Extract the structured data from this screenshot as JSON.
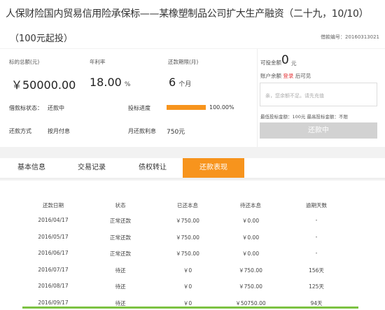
{
  "header": {
    "title": "人保财险国内贸易信用险承保标——某橡塑制品公司扩大生产融资（二十九，10/10）",
    "subtitle": "（100元起投）",
    "loan_no": "借款编号：20160313021"
  },
  "stats": {
    "total_label": "标的总额(元)",
    "total_value": "￥50000.00",
    "rate_label": "年利率",
    "rate_value": "18.00",
    "rate_unit": "%",
    "term_label": "还款期限(月)",
    "term_value": "6",
    "term_unit": "个月"
  },
  "info": {
    "status_label": "借款标状态：",
    "status_value": "还款中",
    "progress_label": "投标进度",
    "progress_value": "100.00%",
    "progress_fraction": 1.0,
    "method_label": "还款方式",
    "method_value": "按月付息",
    "monthly_label": "月还款利息",
    "monthly_value": "750元"
  },
  "invest": {
    "available_label": "可投金额",
    "available_value": "0",
    "available_unit": "元",
    "balance_prefix": "账户余额",
    "login_link": "登录",
    "balance_suffix": "后可见",
    "input_placeholder": "亲，您余额不足。请先充值",
    "limits": "最低投标金额：100元 最高投标金额：不限",
    "button_label": "还款中"
  },
  "tabs": [
    "基本信息",
    "交易记录",
    "债权转让",
    "还款表现"
  ],
  "table": {
    "headers": [
      "还款日期",
      "状态",
      "已还本息",
      "待还本息",
      "逾期天数"
    ],
    "rows": [
      [
        "2016/04/17",
        "正常还款",
        "￥750.00",
        "￥0.00",
        "-"
      ],
      [
        "2016/05/17",
        "正常还款",
        "￥750.00",
        "￥0.00",
        "-"
      ],
      [
        "2016/06/17",
        "正常还款",
        "￥750.00",
        "￥0.00",
        "-"
      ],
      [
        "2016/07/17",
        "待还",
        "￥0",
        "￥750.00",
        "156天"
      ],
      [
        "2016/08/17",
        "待还",
        "￥0",
        "￥750.00",
        "125天"
      ],
      [
        "2016/09/17",
        "待还",
        "￥0",
        "￥50750.00",
        "94天"
      ]
    ]
  },
  "colors": {
    "accent": "#f7941d",
    "link": "#e4393c",
    "footer_bar": "#7cc242"
  }
}
